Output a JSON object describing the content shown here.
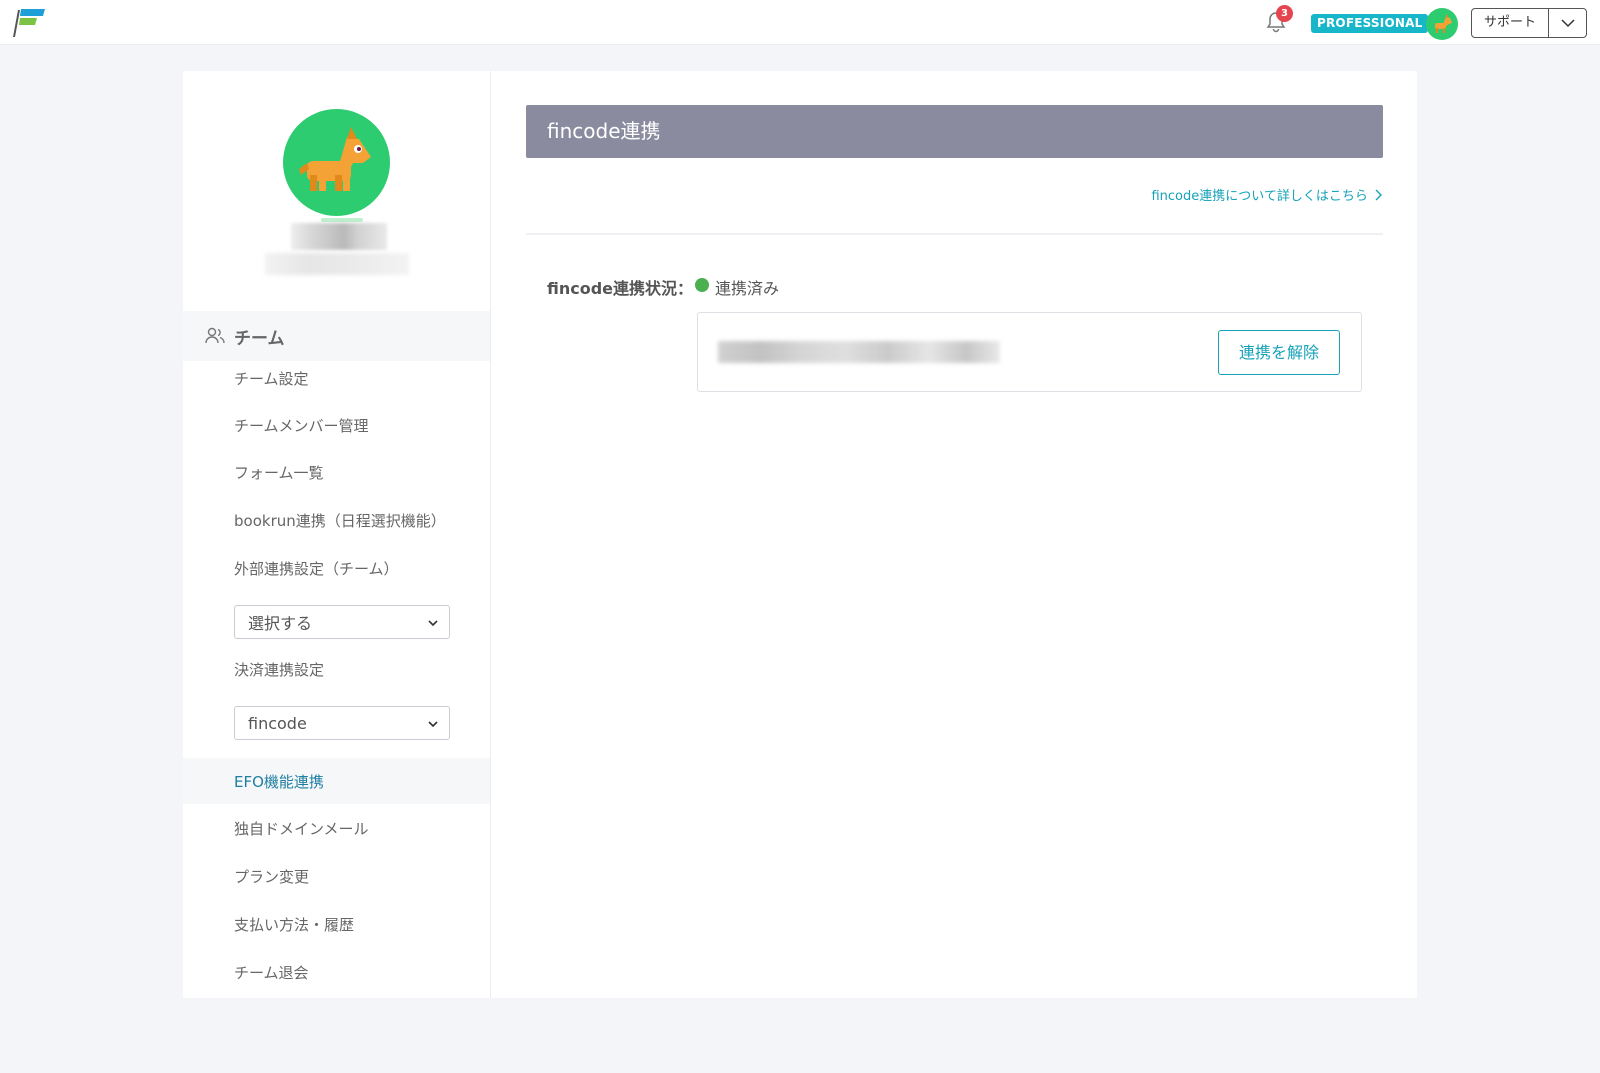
{
  "header": {
    "notification_count": "3",
    "plan_badge": "PROFESSIONAL",
    "support_label": "サポート"
  },
  "sidebar": {
    "team_title": "チーム",
    "items": [
      {
        "label": "チーム設定"
      },
      {
        "label": "チームメンバー管理"
      },
      {
        "label": "フォーム一覧"
      },
      {
        "label": "bookrun連携（日程選択機能）"
      }
    ],
    "external_settings": {
      "label": "外部連携設定（チーム）",
      "select_value": "選択する"
    },
    "payment_settings": {
      "label": "決済連携設定",
      "select_value": "fincode"
    },
    "items_after": [
      {
        "label": "EFO機能連携",
        "active": true
      },
      {
        "label": "独自ドメインメール"
      },
      {
        "label": "プラン変更"
      },
      {
        "label": "支払い方法・履歴"
      },
      {
        "label": "チーム退会"
      }
    ]
  },
  "main": {
    "title": "fincode連携",
    "help_link": "fincode連携について詳しくはこちら",
    "status_label": "fincode連携状況：",
    "status_value": "連携済み",
    "status_color": "#4caf50",
    "unlink_button": "連携を解除"
  },
  "colors": {
    "accent": "#17a2b8",
    "header_bg": "#8a8b9e",
    "avatar_bg": "#2ecc71",
    "badge_red": "#e5454e"
  }
}
